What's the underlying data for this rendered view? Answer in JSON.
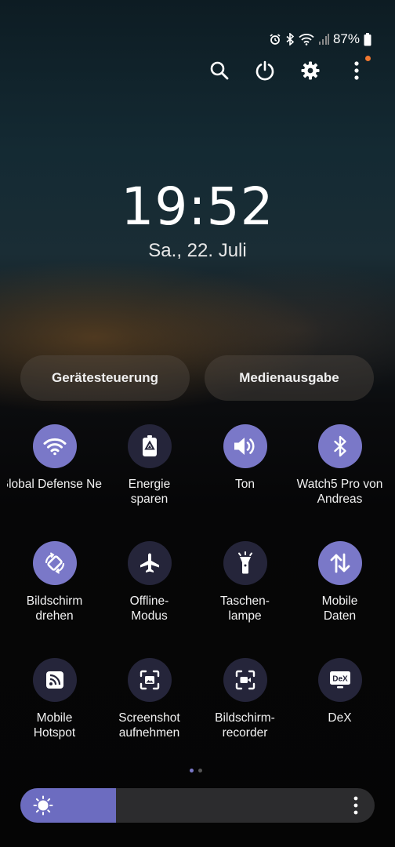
{
  "status_bar": {
    "battery_text": "87%",
    "icons": [
      "alarm-icon",
      "bluetooth-icon",
      "wifi-icon",
      "signal-icon",
      "battery-icon"
    ]
  },
  "top_actions": [
    "search-icon",
    "power-icon",
    "settings-icon",
    "more-icon"
  ],
  "clock": {
    "time": "19:52",
    "date": "Sa., 22. Juli"
  },
  "pills": {
    "device_control": "Gerätesteuerung",
    "media_output": "Medienausgabe"
  },
  "tiles": [
    {
      "label": "Global Defense Ne",
      "icon": "wifi-icon",
      "active": true
    },
    {
      "label": "Energie\nsparen",
      "icon": "battery-saver-icon",
      "active": false
    },
    {
      "label": "Ton",
      "icon": "sound-icon",
      "active": true
    },
    {
      "label": "Watch5 Pro von\nAndreas",
      "icon": "bluetooth-icon",
      "active": true
    },
    {
      "label": "Bildschirm\ndrehen",
      "icon": "rotate-icon",
      "active": true
    },
    {
      "label": "Offline-\nModus",
      "icon": "airplane-icon",
      "active": false
    },
    {
      "label": "Taschen-\nlampe",
      "icon": "flashlight-icon",
      "active": false
    },
    {
      "label": "Mobile\nDaten",
      "icon": "mobile-data-icon",
      "active": true
    },
    {
      "label": "Mobile\nHotspot",
      "icon": "hotspot-icon",
      "active": false
    },
    {
      "label": "Screenshot\naufnehmen",
      "icon": "screenshot-icon",
      "active": false
    },
    {
      "label": "Bildschirm-\nrecorder",
      "icon": "screen-recorder-icon",
      "active": false
    },
    {
      "label": "DeX",
      "icon": "dex-icon",
      "active": false
    }
  ],
  "page_indicator": {
    "pages": 2,
    "current": 1
  },
  "brightness": {
    "level": 0.27
  },
  "colors": {
    "accent": "#7a78c8",
    "tile_off": "#25253a",
    "notification_dot": "#f07830"
  }
}
